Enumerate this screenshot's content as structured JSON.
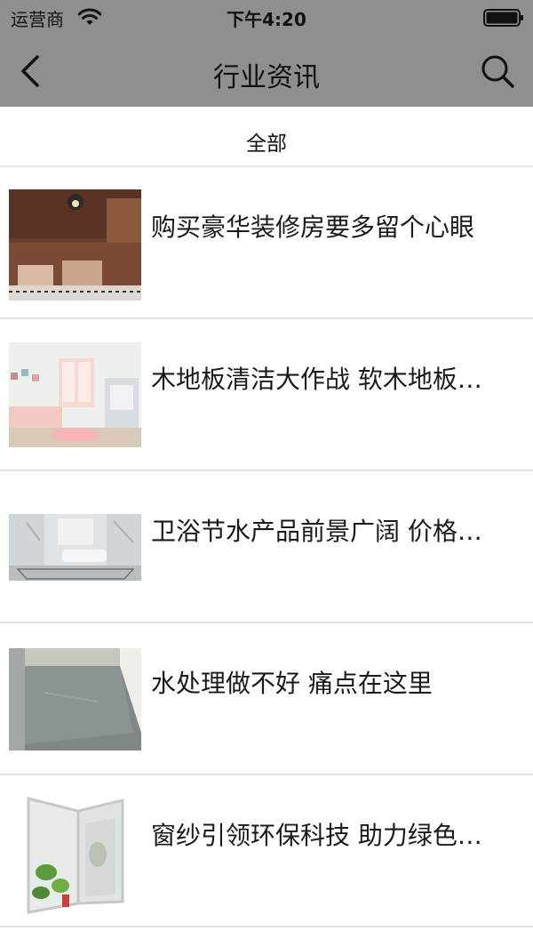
{
  "status_bar": {
    "carrier": "运营商",
    "time": "下午4:20"
  },
  "nav": {
    "title": "行业资讯",
    "back_icon": "chevron-left-icon",
    "search_icon": "search-icon",
    "background_color": "#8f8f8f"
  },
  "filter": {
    "tabs": [
      {
        "label": "全部"
      }
    ]
  },
  "news": [
    {
      "title": "购买豪华装修房要多留个心眼",
      "image": "restaurant-interior"
    },
    {
      "title": "木地板清洁大作战 软木地板…",
      "image": "living-room"
    },
    {
      "title": "卫浴节水产品前景广阔 价格…",
      "image": "bathroom"
    },
    {
      "title": "水处理做不好 痛点在这里",
      "image": "gray-floor"
    },
    {
      "title": "窗纱引领环保科技 助力绿色…",
      "image": "window-screen"
    }
  ]
}
